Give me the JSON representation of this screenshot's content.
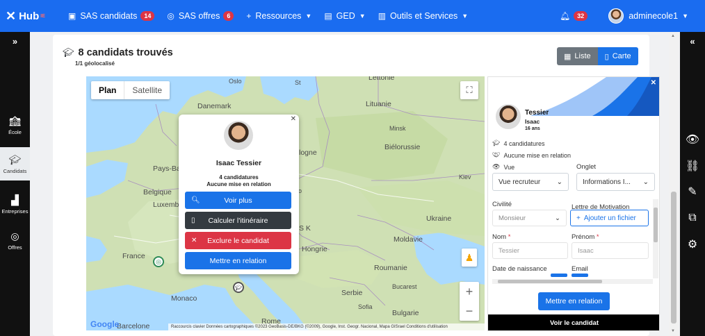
{
  "nav": {
    "logo": "Hub",
    "logo_sup": "IE",
    "items": [
      {
        "label": "SAS candidats",
        "badge": "14"
      },
      {
        "label": "SAS offres",
        "badge": "6"
      },
      {
        "label": "Ressources"
      },
      {
        "label": "GED"
      },
      {
        "label": "Outils et Services"
      }
    ],
    "notifications": "32",
    "user": "adminecole1"
  },
  "left_sidebar": {
    "expand": "»",
    "items": [
      {
        "label": "École"
      },
      {
        "label": "Candidats"
      },
      {
        "label": "Entreprises"
      },
      {
        "label": "Offres"
      }
    ]
  },
  "right_sidebar": {
    "collapse": "«"
  },
  "results": {
    "title": "8 candidats trouvés",
    "subtitle": "1/1 géolocalisé",
    "view_liste": "Liste",
    "view_carte": "Carte"
  },
  "map": {
    "type_plan": "Plan",
    "type_satellite": "Satellite",
    "google": "Google",
    "attribution": "Raccourcis clavier    Données cartographiques ©2023 GeoBasis-DE/BKG (©2009), Google, Inst. Geogr. Nacional, Mapa GISrael    Conditions d'utilisation",
    "labels": {
      "lettonie": "Lettonie",
      "danemark": "Danemark",
      "lituanie": "Lituanie",
      "minsk": "Minsk",
      "bielorussie": "Biélorussie",
      "logne": "logne",
      "paysbas": "Pays-Bas",
      "belgique": "Belgique",
      "luxembourg": "Luxembourg",
      "ukraine": "Ukraine",
      "kiev": "Kiev",
      "moldavie": "Moldavie",
      "france": "France",
      "hongrie": "Hongrie",
      "roumanie": "Roumanie",
      "serbie": "Serbie",
      "bucarest": "Bucarest",
      "monaco": "Monaco",
      "rome": "Rome",
      "barcelone": "Barcelone",
      "sofia": "Sofia",
      "bulgarie": "Bulgarie",
      "sk": "S K",
      "st": "St",
      "lo": "Lo",
      "oslo": "Oslo"
    }
  },
  "infowindow": {
    "name": "Isaac Tessier",
    "candidatures": "4 candidatures",
    "relation": "Aucune mise en relation",
    "btn_voir": "Voir plus",
    "btn_itineraire": "Calculer l'itinéraire",
    "btn_exclure": "Exclure le candidat",
    "btn_relation": "Mettre en relation"
  },
  "panel": {
    "lastname": "Tessier",
    "firstname": "Isaac",
    "age": "16 ans",
    "candidatures": "4 candidatures",
    "relation": "Aucune mise en relation",
    "vue_label": "Vue",
    "vue_value": "Vue recruteur",
    "onglet_label": "Onglet",
    "onglet_value": "Informations I...",
    "civilite_label": "Civilité",
    "civilite_value": "Monsieur",
    "motivation_label": "Lettre de Motivation",
    "upload_label": "Ajouter un fichier",
    "nom_label": "Nom",
    "nom_value": "Tessier",
    "prenom_label": "Prénom",
    "prenom_value": "Isaac",
    "naissance_label": "Date de naissance",
    "email_label": "Email",
    "btn_relation": "Mettre en relation",
    "btn_voir": "Voir le candidat"
  },
  "colors": {
    "primary": "#1a73e8",
    "danger": "#dc3545",
    "nav": "#1a6cf0",
    "dark": "#343a40"
  }
}
